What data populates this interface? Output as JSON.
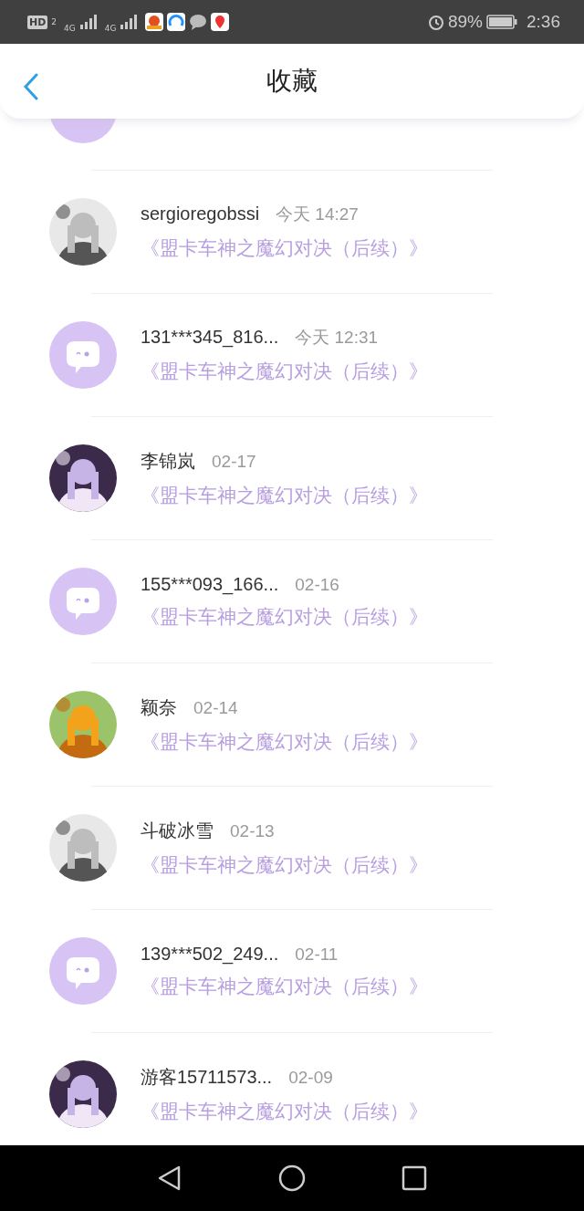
{
  "status_bar": {
    "hd": "HD",
    "sim": "2",
    "network_1": "4G",
    "network_2": "4G",
    "battery": "89%",
    "time": "2:36"
  },
  "header": {
    "title": "收藏"
  },
  "partial_row": {
    "avatar": {
      "kind": "default"
    }
  },
  "items": [
    {
      "name": "sergioregobssi",
      "time": "今天 14:27",
      "title": "《盟卡车神之魔幻对决（后续）》"
    },
    {
      "avatar": {
        "kind": "default"
      },
      "name": "131***345_816...",
      "time": "今天 12:31",
      "title": "《盟卡车神之魔幻对决（后续）》"
    },
    {
      "name": "李锦岚",
      "time": "02-17",
      "title": "《盟卡车神之魔幻对决（后续）》"
    },
    {
      "avatar": {
        "kind": "default"
      },
      "name": "155***093_166...",
      "time": "02-16",
      "title": "《盟卡车神之魔幻对决（后续）》"
    },
    {
      "name": "颖奈",
      "time": "02-14",
      "title": "《盟卡车神之魔幻对决（后续）》"
    },
    {
      "name": "斗破冰雪",
      "time": "02-13",
      "title": "《盟卡车神之魔幻对决（后续）》"
    },
    {
      "avatar": {
        "kind": "default"
      },
      "name": "139***502_249...",
      "time": "02-11",
      "title": "《盟卡车神之魔幻对决（后续）》"
    },
    {
      "name": "游客15711573...",
      "time": "02-09",
      "title": "《盟卡车神之魔幻对决（后续）》"
    }
  ]
}
